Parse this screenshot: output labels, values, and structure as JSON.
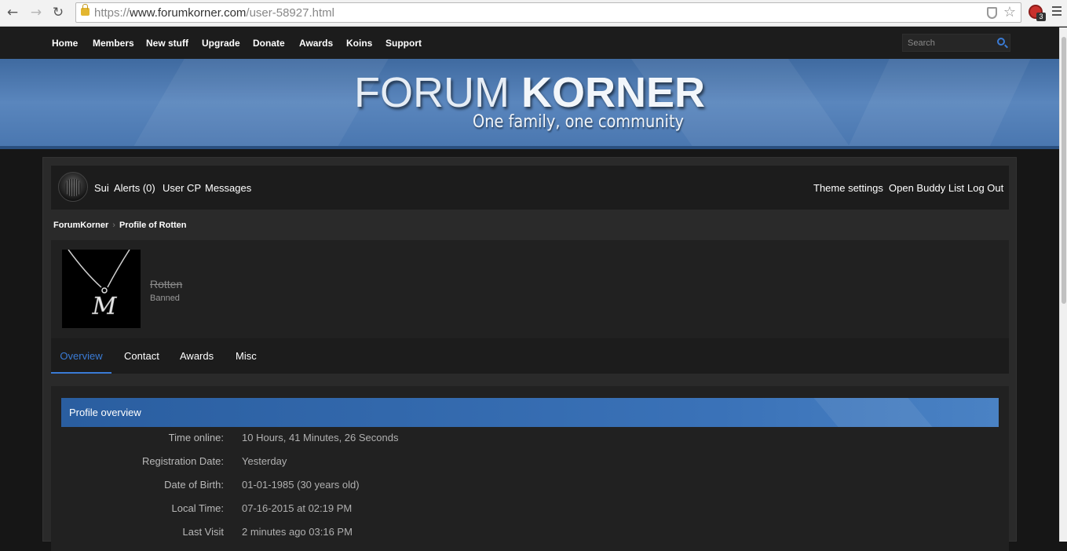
{
  "browser": {
    "url_scheme": "https://",
    "url_host": "www.forumkorner.com",
    "url_path": "/user-58927.html",
    "ext_badge": "3",
    "back_glyph": "←",
    "forward_glyph": "→",
    "reload_glyph": "↻",
    "star_glyph": "☆"
  },
  "topnav": {
    "items": [
      "Home",
      "Members",
      "New stuff",
      "Upgrade",
      "Donate",
      "Awards",
      "Koins",
      "Support"
    ],
    "search_placeholder": "Search"
  },
  "banner": {
    "logo_light": "FORUM ",
    "logo_bold": "KORNER",
    "tagline": "One family, one community"
  },
  "userbar": {
    "username": "Sui",
    "alerts": "Alerts (0)",
    "usercp": "User CP",
    "messages": "Messages",
    "theme_settings": "Theme settings",
    "buddy_list": "Open Buddy List",
    "logout": "Log Out"
  },
  "breadcrumb": {
    "root": "ForumKorner",
    "separator": "›",
    "current": "Profile of Rotten"
  },
  "profile": {
    "username": "Rotten",
    "usertitle": "Banned"
  },
  "tabs": [
    "Overview",
    "Contact",
    "Awards",
    "Misc"
  ],
  "overview": {
    "title": "Profile overview",
    "rows": [
      {
        "label": "Time online:",
        "value": "10 Hours, 41 Minutes, 26 Seconds"
      },
      {
        "label": "Registration Date:",
        "value": "Yesterday"
      },
      {
        "label": "Date of Birth:",
        "value": "01-01-1985 (30 years old)"
      },
      {
        "label": "Local Time:",
        "value": "07-16-2015 at 02:19 PM"
      },
      {
        "label": "Last Visit",
        "value": "2 minutes ago 03:16 PM"
      }
    ]
  },
  "colors": {
    "accent": "#3a7bd5",
    "banner": "#4a77b0",
    "background": "#161616"
  }
}
